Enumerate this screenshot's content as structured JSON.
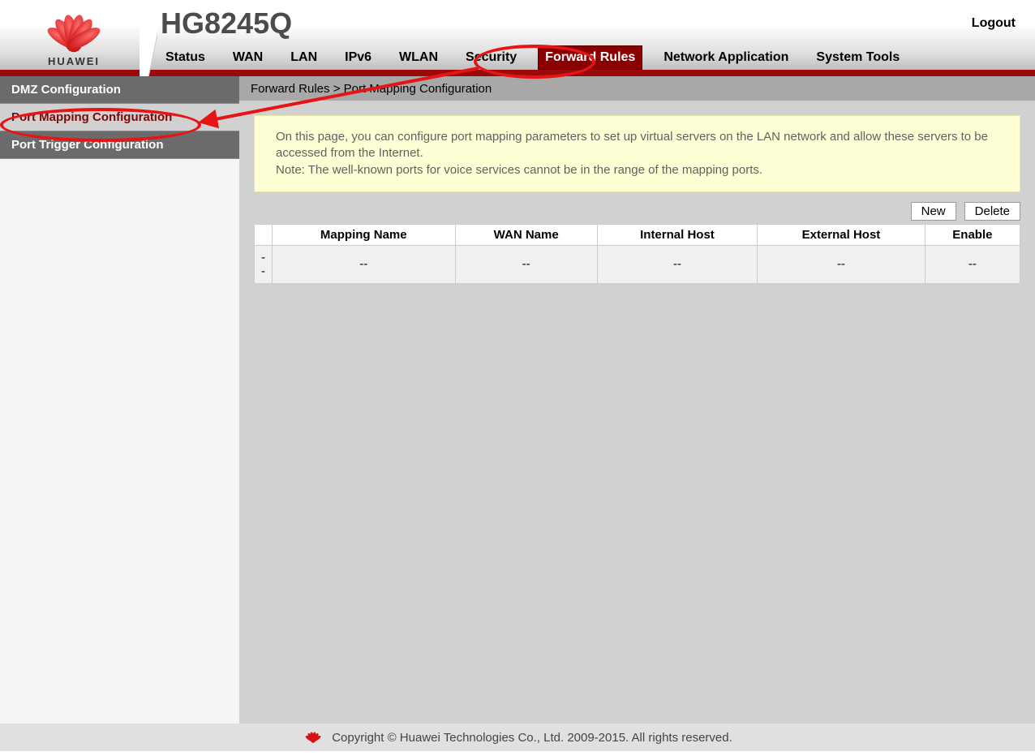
{
  "brand": "HUAWEI",
  "device_model": "HG8245Q",
  "logout_label": "Logout",
  "topnav": {
    "items": [
      {
        "label": "Status"
      },
      {
        "label": "WAN"
      },
      {
        "label": "LAN"
      },
      {
        "label": "IPv6"
      },
      {
        "label": "WLAN"
      },
      {
        "label": "Security"
      },
      {
        "label": "Forward Rules",
        "active": true
      },
      {
        "label": "Network Application"
      },
      {
        "label": "System Tools"
      }
    ]
  },
  "sidebar": {
    "items": [
      {
        "label": "DMZ Configuration"
      },
      {
        "label": "Port Mapping Configuration",
        "active": true
      },
      {
        "label": "Port Trigger Configuration"
      }
    ]
  },
  "breadcrumb": "Forward Rules > Port Mapping Configuration",
  "description": {
    "line1": "On this page, you can configure port mapping parameters to set up virtual servers on the LAN network and allow these servers to be accessed from the Internet.",
    "line2": "Note: The well-known ports for voice services cannot be in the range of the mapping ports."
  },
  "toolbar": {
    "new_label": "New",
    "delete_label": "Delete"
  },
  "table": {
    "headers": [
      "",
      "Mapping Name",
      "WAN Name",
      "Internal Host",
      "External Host",
      "Enable"
    ],
    "rows": [
      {
        "checkbox": "--",
        "mapping_name": "--",
        "wan_name": "--",
        "internal_host": "--",
        "external_host": "--",
        "enable": "--"
      }
    ]
  },
  "footer_text": "Copyright © Huawei Technologies Co., Ltd. 2009-2015. All rights reserved.",
  "annotation": {
    "circle_topnav": true,
    "circle_sidebar": true,
    "arrow": true
  },
  "colors": {
    "accent_dark_red": "#8a0000",
    "annotation_red": "#e61414"
  }
}
